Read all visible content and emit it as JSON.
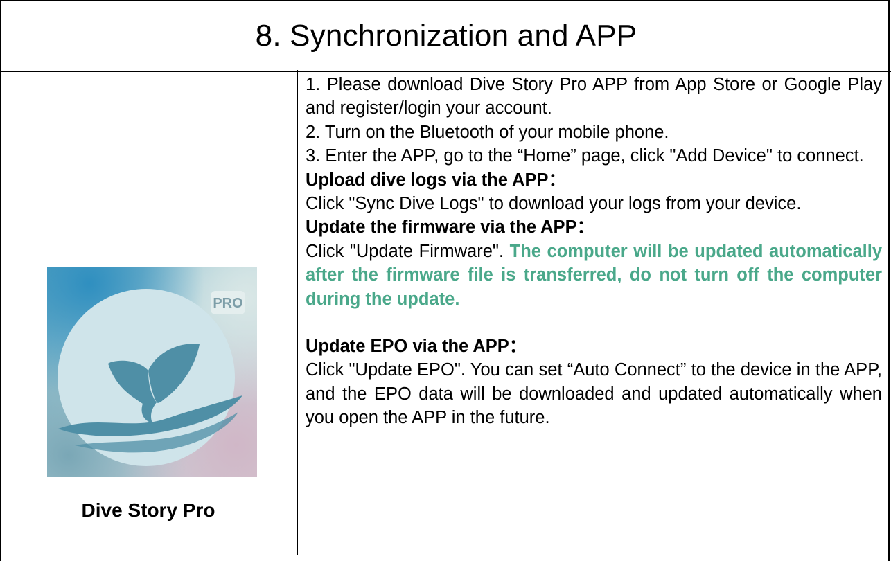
{
  "section": {
    "title": "8. Synchronization and APP"
  },
  "app": {
    "name": "Dive Story Pro",
    "badge": "PRO",
    "colors": {
      "circle": "#cde4ea",
      "whale_tail": "#4f8fa6",
      "wave": "#4f8fa6"
    }
  },
  "instructions": {
    "step1": "1. Please download Dive Story Pro APP from App Store or Google Play and register/login your account.",
    "step2": "2. Turn on the Bluetooth of your mobile phone.",
    "step3": "3. Enter the APP, go to the “Home” page, click \"Add Device\" to connect.",
    "upload_heading": "Upload dive logs via the APP：",
    "upload_text": "Click \"Sync Dive Logs\" to download your logs from your device.",
    "firmware_heading": "Update the firmware via the APP：",
    "firmware_text": "Click \"Update Firmware\".",
    "firmware_warning": "The computer will be updated automatically after the firmware file is transferred, do not turn off the computer during the update.",
    "epo_heading": "Update EPO via the APP：",
    "epo_text": "Click \"Update EPO\". You can set “Auto Connect” to the device in the APP, and the EPO data will be downloaded and updated automatically when you open the APP in the future."
  },
  "theme": {
    "warning_color": "#4aa88a",
    "border_color": "#000000"
  }
}
